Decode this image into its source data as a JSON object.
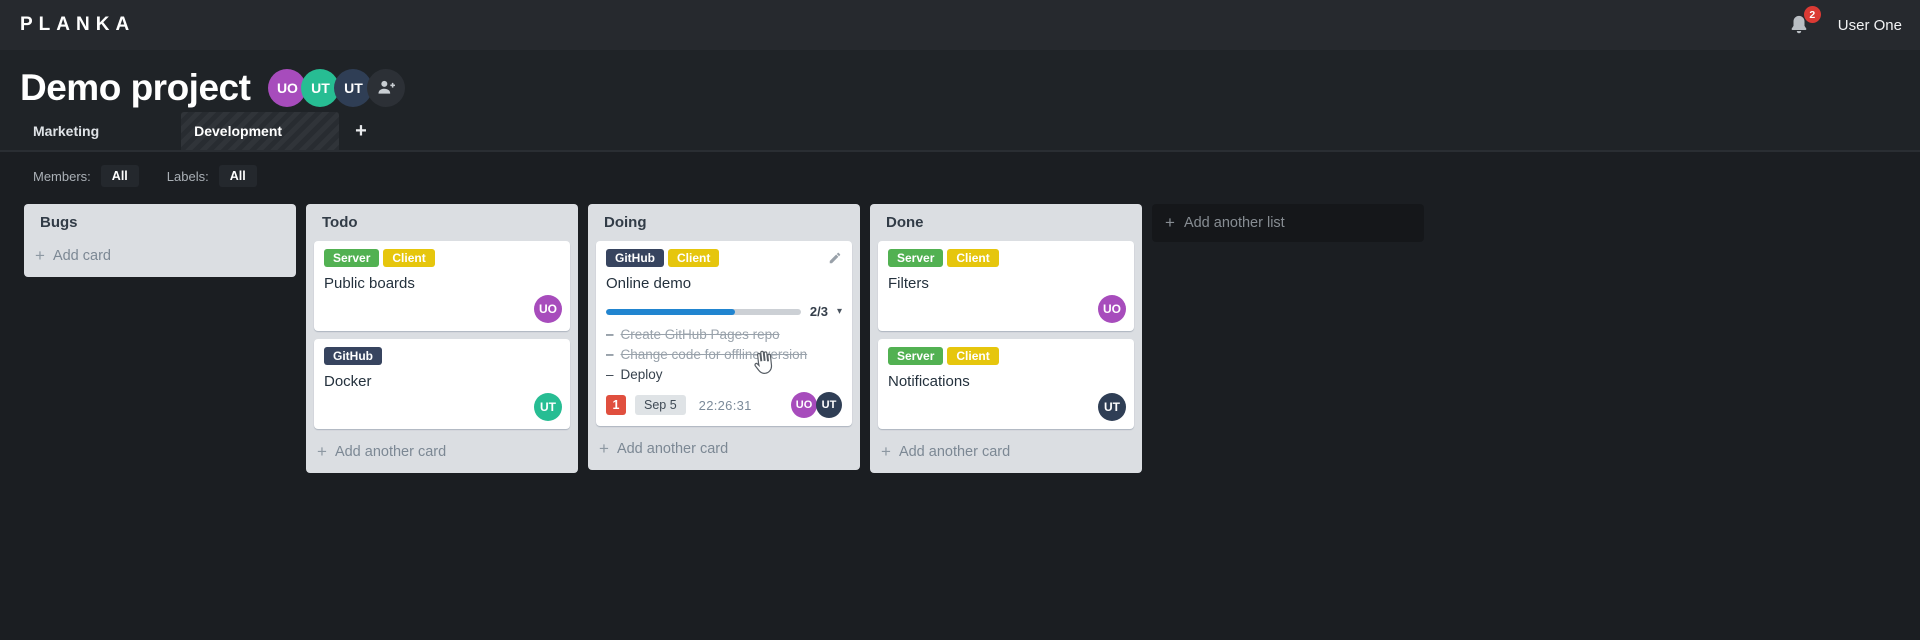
{
  "header": {
    "logo": "PLANKA",
    "notifications": {
      "count": "2",
      "badge_color": "#db3a34"
    },
    "user_name": "User One"
  },
  "project": {
    "title": "Demo project",
    "members": [
      {
        "initials": "UO",
        "color": "#a74cbc"
      },
      {
        "initials": "UT",
        "color": "#27bd93"
      },
      {
        "initials": "UT",
        "color": "#2f3e55"
      }
    ]
  },
  "boards_tabs": {
    "tabs": [
      {
        "label": "Marketing",
        "active": false
      },
      {
        "label": "Development",
        "active": true
      }
    ]
  },
  "filters": {
    "members_label": "Members:",
    "members_value": "All",
    "labels_label": "Labels:",
    "labels_value": "All"
  },
  "glyphs": {
    "plus": "+",
    "caret_down": "▾",
    "task_dash": "–"
  },
  "board": {
    "add_list_label": "Add another list",
    "lists": [
      {
        "title": "Bugs",
        "add_card_label": "Add card",
        "cards": []
      },
      {
        "title": "Todo",
        "add_card_label": "Add another card",
        "cards": [
          {
            "name": "Public boards",
            "labels": [
              {
                "text": "Server",
                "color": "#52b152"
              },
              {
                "text": "Client",
                "color": "#e6c60d"
              }
            ],
            "members": [
              {
                "initials": "UO",
                "color": "#a74cbc"
              }
            ]
          },
          {
            "name": "Docker",
            "labels": [
              {
                "text": "GitHub",
                "color": "#37445f"
              }
            ],
            "members": [
              {
                "initials": "UT",
                "color": "#27bd93"
              }
            ]
          }
        ]
      },
      {
        "title": "Doing",
        "add_card_label": "Add another card",
        "cards": [
          {
            "name": "Online demo",
            "labels": [
              {
                "text": "GitHub",
                "color": "#37445f"
              },
              {
                "text": "Client",
                "color": "#e6c60d"
              }
            ],
            "has_edit_button": true,
            "progress": {
              "completed": 2,
              "total": 3,
              "percent": 66,
              "label": "2/3",
              "bar_color": "#2185d0"
            },
            "tasks": [
              {
                "text": "Create GitHub Pages repo",
                "done": true
              },
              {
                "text": "Change code for offline version",
                "done": true
              },
              {
                "text": "Deploy",
                "done": false
              }
            ],
            "notification_count": "1",
            "notification_color": "#e04f3e",
            "due_date": "Sep 5",
            "timer": "22:26:31",
            "members": [
              {
                "initials": "UO",
                "color": "#a74cbc"
              },
              {
                "initials": "UT",
                "color": "#2f3e55"
              }
            ]
          }
        ]
      },
      {
        "title": "Done",
        "add_card_label": "Add another card",
        "cards": [
          {
            "name": "Filters",
            "labels": [
              {
                "text": "Server",
                "color": "#52b152"
              },
              {
                "text": "Client",
                "color": "#e6c60d"
              }
            ],
            "members": [
              {
                "initials": "UO",
                "color": "#a74cbc"
              }
            ]
          },
          {
            "name": "Notifications",
            "labels": [
              {
                "text": "Server",
                "color": "#52b152"
              },
              {
                "text": "Client",
                "color": "#e6c60d"
              }
            ],
            "members": [
              {
                "initials": "UT",
                "color": "#2f3e55"
              }
            ]
          }
        ]
      }
    ]
  }
}
